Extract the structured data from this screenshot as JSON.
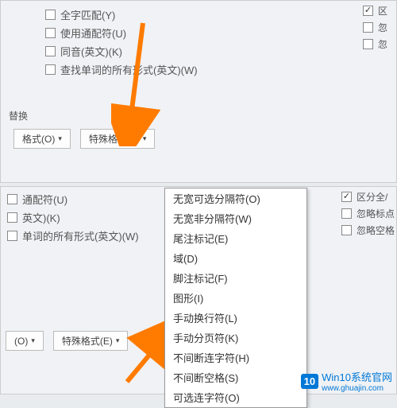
{
  "top": {
    "options": [
      {
        "label": "全字匹配(Y)",
        "checked": false
      },
      {
        "label": "使用通配符(U)",
        "checked": false
      },
      {
        "label": "同音(英文)(K)",
        "checked": false
      },
      {
        "label": "查找单词的所有形式(英文)(W)",
        "checked": false
      }
    ],
    "right": [
      {
        "label": "区",
        "checked": true
      },
      {
        "label": "忽",
        "checked": false
      },
      {
        "label": "忽",
        "checked": false
      }
    ],
    "section_label": "替换",
    "format_btn": "格式(O)",
    "special_btn": "特殊格式(E)"
  },
  "bottom": {
    "options": [
      {
        "label": "通配符(U)",
        "checked": false
      },
      {
        "label": "英文)(K)",
        "checked": false
      },
      {
        "label": "单词的所有形式(英文)(W)",
        "checked": false
      }
    ],
    "right": [
      {
        "label": "区分全/",
        "checked": true
      },
      {
        "label": "忽略标点",
        "checked": false
      },
      {
        "label": "忽略空格",
        "checked": false
      }
    ],
    "format_btn": "(O)",
    "special_btn": "特殊格式(E)"
  },
  "menu": {
    "items": [
      "无宽可选分隔符(O)",
      "无宽非分隔符(W)",
      "尾注标记(E)",
      "域(D)",
      "脚注标记(F)",
      "图形(I)",
      "手动换行符(L)",
      "手动分页符(K)",
      "不间断连字符(H)",
      "不间断空格(S)",
      "可选连字符(O)"
    ]
  },
  "watermark": {
    "badge": "10",
    "text": "Win10系统官网",
    "url": "www.ghuajin.com"
  }
}
